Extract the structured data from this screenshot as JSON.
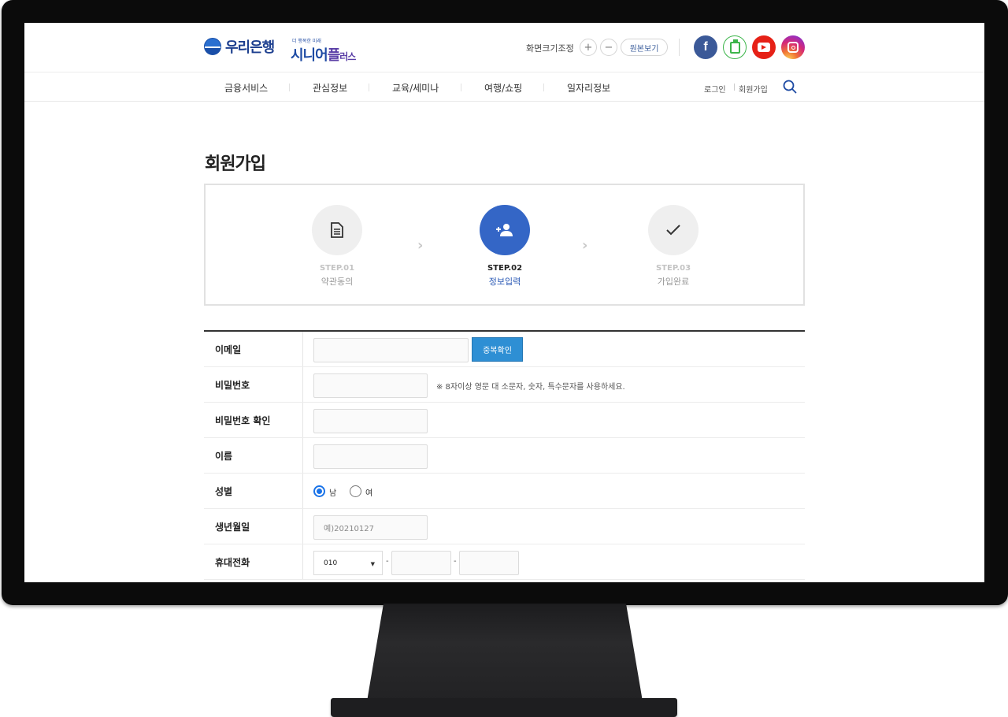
{
  "header": {
    "bank_name": "우리은행",
    "senior_sub": "더 행복한 미래",
    "senior_name_main": "시니어",
    "senior_name_plus": "플",
    "senior_name_small": "러스",
    "zoom_label": "화면크기조정",
    "zoom_in": "+",
    "zoom_out": "−",
    "zoom_reset": "원본보기",
    "social": [
      "facebook-icon",
      "blog-icon",
      "youtube-icon",
      "instagram-icon"
    ]
  },
  "nav": {
    "items": [
      "금융서비스",
      "관심정보",
      "교육/세미나",
      "여행/쇼핑",
      "일자리정보"
    ],
    "login": "로그인",
    "signup": "회원가입"
  },
  "page": {
    "title": "회원가입"
  },
  "steps": [
    {
      "num": "STEP.01",
      "label": "약관동의",
      "icon": "document-icon",
      "active": false
    },
    {
      "num": "STEP.02",
      "label": "정보입력",
      "icon": "add-user-icon",
      "active": true
    },
    {
      "num": "STEP.03",
      "label": "가입완료",
      "icon": "check-icon",
      "active": false
    }
  ],
  "form": {
    "email_label": "이메일",
    "email_value": "",
    "dup_check": "중복확인",
    "password_label": "비밀번호",
    "password_hint": "※ 8자이상 영문 대 소문자, 숫자, 특수문자를 사용하세요.",
    "password_confirm_label": "비밀번호 확인",
    "name_label": "이름",
    "gender_label": "성별",
    "gender_male": "남",
    "gender_female": "여",
    "gender_selected": "남",
    "birth_label": "생년월일",
    "birth_placeholder": "예)20210127",
    "phone_label": "휴대전화",
    "phone_prefix": "010",
    "phone_sep": "-"
  },
  "colors": {
    "accent": "#3466c6",
    "button": "#2e8fd4",
    "bank_blue": "#1d3f8f"
  }
}
